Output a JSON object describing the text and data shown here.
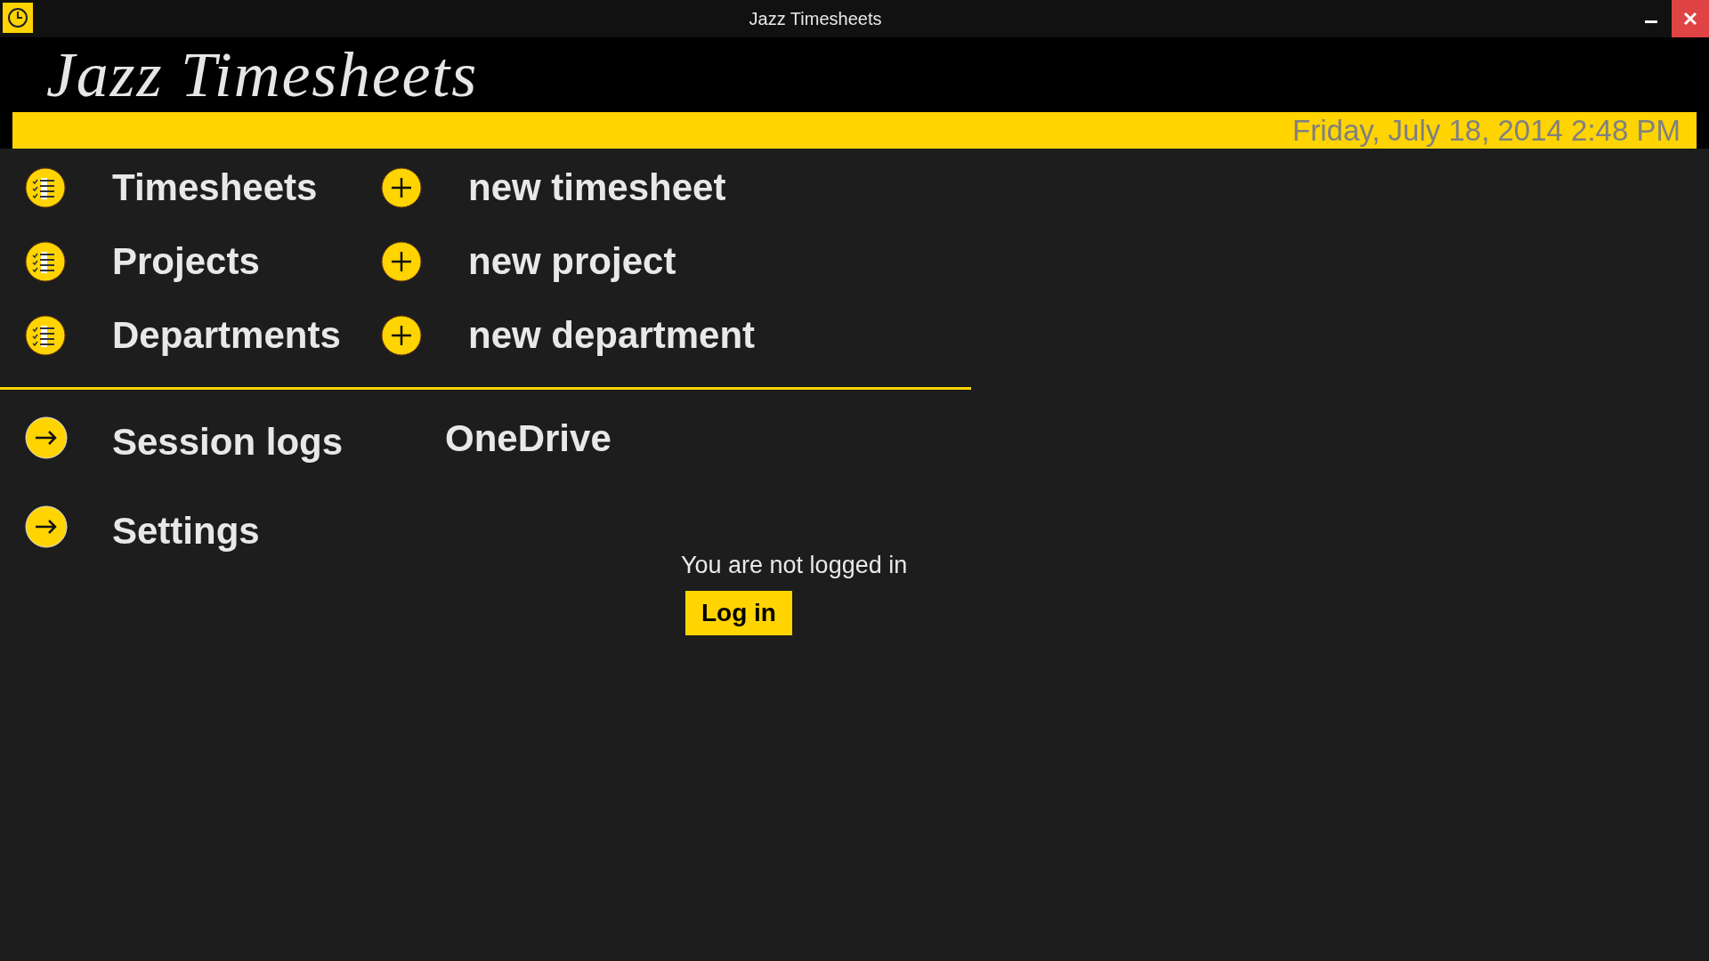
{
  "window": {
    "title": "Jazz Timesheets"
  },
  "header": {
    "title": "Jazz Timesheets"
  },
  "date_bar": {
    "text": "Friday, July 18, 2014 2:48 PM"
  },
  "lists": [
    {
      "label": "Timesheets",
      "new_label": "new timesheet"
    },
    {
      "label": "Projects",
      "new_label": "new project"
    },
    {
      "label": "Departments",
      "new_label": "new department"
    }
  ],
  "links": [
    {
      "label": "Session logs"
    },
    {
      "label": "Settings"
    }
  ],
  "onedrive": {
    "title": "OneDrive",
    "status": "You are not logged in",
    "button": "Log in"
  }
}
